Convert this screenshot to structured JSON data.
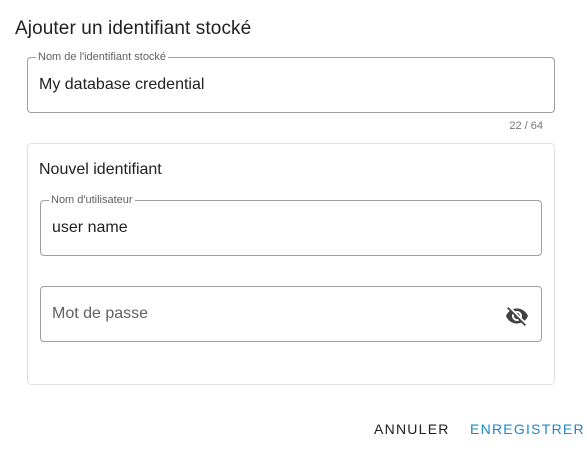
{
  "dialog": {
    "title": "Ajouter un identifiant stocké",
    "name_field": {
      "label": "Nom de l'identifiant stocké",
      "value": "My database credential",
      "counter": "22 / 64"
    },
    "credential": {
      "section_title": "Nouvel identifiant",
      "username": {
        "label": "Nom d'utilisateur",
        "value": "user name"
      },
      "password": {
        "placeholder": "Mot de passe",
        "toggle_icon": "eye-off-icon"
      }
    },
    "actions": {
      "cancel": "ANNULER",
      "save": "ENREGISTRER"
    },
    "colors": {
      "primary": "#1e88c8",
      "text": "#212121",
      "border": "#9e9e9e"
    }
  }
}
